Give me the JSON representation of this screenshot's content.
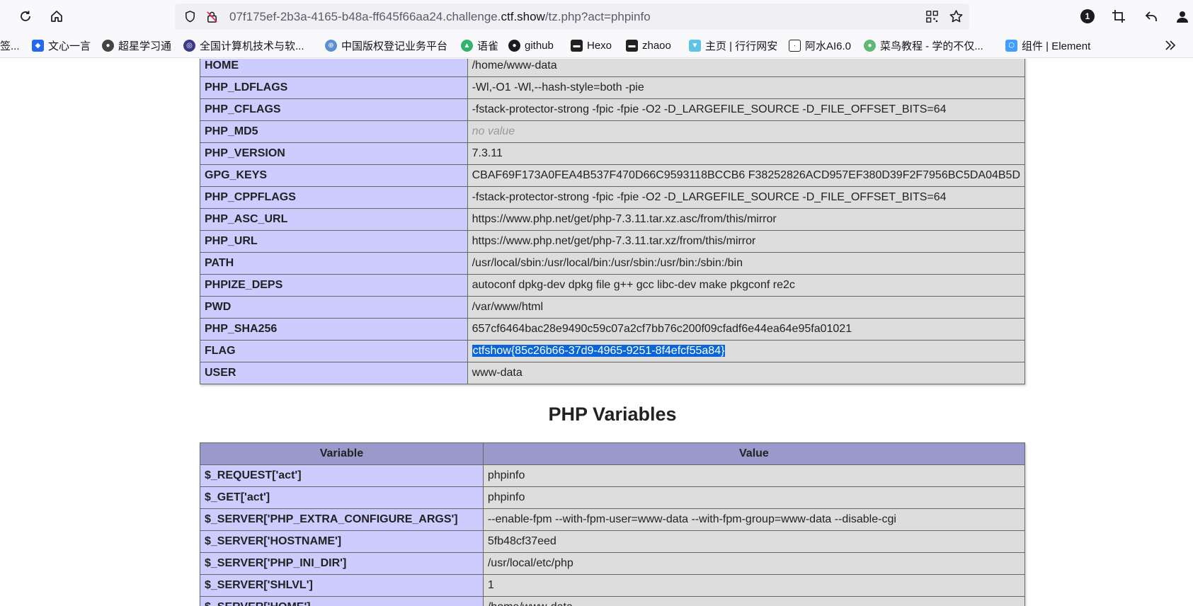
{
  "browser": {
    "url_prefix": "07f175ef-2b3a-4165-b48a-ff645f66aa24.challenge.",
    "url_host": "ctf.show",
    "url_suffix": "/tz.php?act=phpinfo",
    "badge_count": "1"
  },
  "bookmarks": [
    {
      "label": "签...",
      "icon": "bookmark-icon"
    },
    {
      "label": "文心一言",
      "icon": "wenxin-icon"
    },
    {
      "label": "超星学习通",
      "icon": "chaoxing-icon"
    },
    {
      "label": "全国计算机技术与软...",
      "icon": "ruankao-icon"
    },
    {
      "label": "中国版权登记业务平台",
      "icon": "copyright-icon"
    },
    {
      "label": "语雀",
      "icon": "yuque-icon"
    },
    {
      "label": "github",
      "icon": "github-icon"
    },
    {
      "label": "Hexo",
      "icon": "hexo-icon"
    },
    {
      "label": "zhaoo",
      "icon": "zhaoo-icon"
    },
    {
      "label": "主页 | 行行网安",
      "icon": "hanghang-icon"
    },
    {
      "label": "阿水AI6.0",
      "icon": "ashui-icon"
    },
    {
      "label": "菜鸟教程 - 学的不仅...",
      "icon": "runoob-icon"
    },
    {
      "label": "组件 | Element",
      "icon": "element-icon"
    }
  ],
  "env_rows": [
    {
      "key": "HOME",
      "value": "/home/www-data"
    },
    {
      "key": "PHP_LDFLAGS",
      "value": "-Wl,-O1 -Wl,--hash-style=both -pie"
    },
    {
      "key": "PHP_CFLAGS",
      "value": "-fstack-protector-strong -fpic -fpie -O2 -D_LARGEFILE_SOURCE -D_FILE_OFFSET_BITS=64"
    },
    {
      "key": "PHP_MD5",
      "value": "no value",
      "novalue": true
    },
    {
      "key": "PHP_VERSION",
      "value": "7.3.11"
    },
    {
      "key": "GPG_KEYS",
      "value": "CBAF69F173A0FEA4B537F470D66C9593118BCCB6 F38252826ACD957EF380D39F2F7956BC5DA04B5D"
    },
    {
      "key": "PHP_CPPFLAGS",
      "value": "-fstack-protector-strong -fpic -fpie -O2 -D_LARGEFILE_SOURCE -D_FILE_OFFSET_BITS=64"
    },
    {
      "key": "PHP_ASC_URL",
      "value": "https://www.php.net/get/php-7.3.11.tar.xz.asc/from/this/mirror"
    },
    {
      "key": "PHP_URL",
      "value": "https://www.php.net/get/php-7.3.11.tar.xz/from/this/mirror"
    },
    {
      "key": "PATH",
      "value": "/usr/local/sbin:/usr/local/bin:/usr/sbin:/usr/bin:/sbin:/bin"
    },
    {
      "key": "PHPIZE_DEPS",
      "value": "autoconf dpkg-dev dpkg file g++ gcc libc-dev make pkgconf re2c"
    },
    {
      "key": "PWD",
      "value": "/var/www/html"
    },
    {
      "key": "PHP_SHA256",
      "value": "657cf6464bac28e9490c59c07a2cf7bb76c200f09cfadf6e44ea64e95fa01021"
    },
    {
      "key": "FLAG",
      "value": "ctfshow{85c26b66-37d9-4965-9251-8f4efcf55a84}",
      "selected": true
    },
    {
      "key": "USER",
      "value": "www-data"
    }
  ],
  "php_variables": {
    "title": "PHP Variables",
    "col_variable": "Variable",
    "col_value": "Value",
    "rows": [
      {
        "key": "$_REQUEST['act']",
        "value": "phpinfo"
      },
      {
        "key": "$_GET['act']",
        "value": "phpinfo"
      },
      {
        "key": "$_SERVER['PHP_EXTRA_CONFIGURE_ARGS']",
        "value": "--enable-fpm --with-fpm-user=www-data --with-fpm-group=www-data --disable-cgi"
      },
      {
        "key": "$_SERVER['HOSTNAME']",
        "value": "5fb48cf37eed"
      },
      {
        "key": "$_SERVER['PHP_INI_DIR']",
        "value": "/usr/local/etc/php"
      },
      {
        "key": "$_SERVER['SHLVL']",
        "value": "1"
      },
      {
        "key": "$_SERVER['HOME']",
        "value": "/home/www-data"
      }
    ]
  }
}
